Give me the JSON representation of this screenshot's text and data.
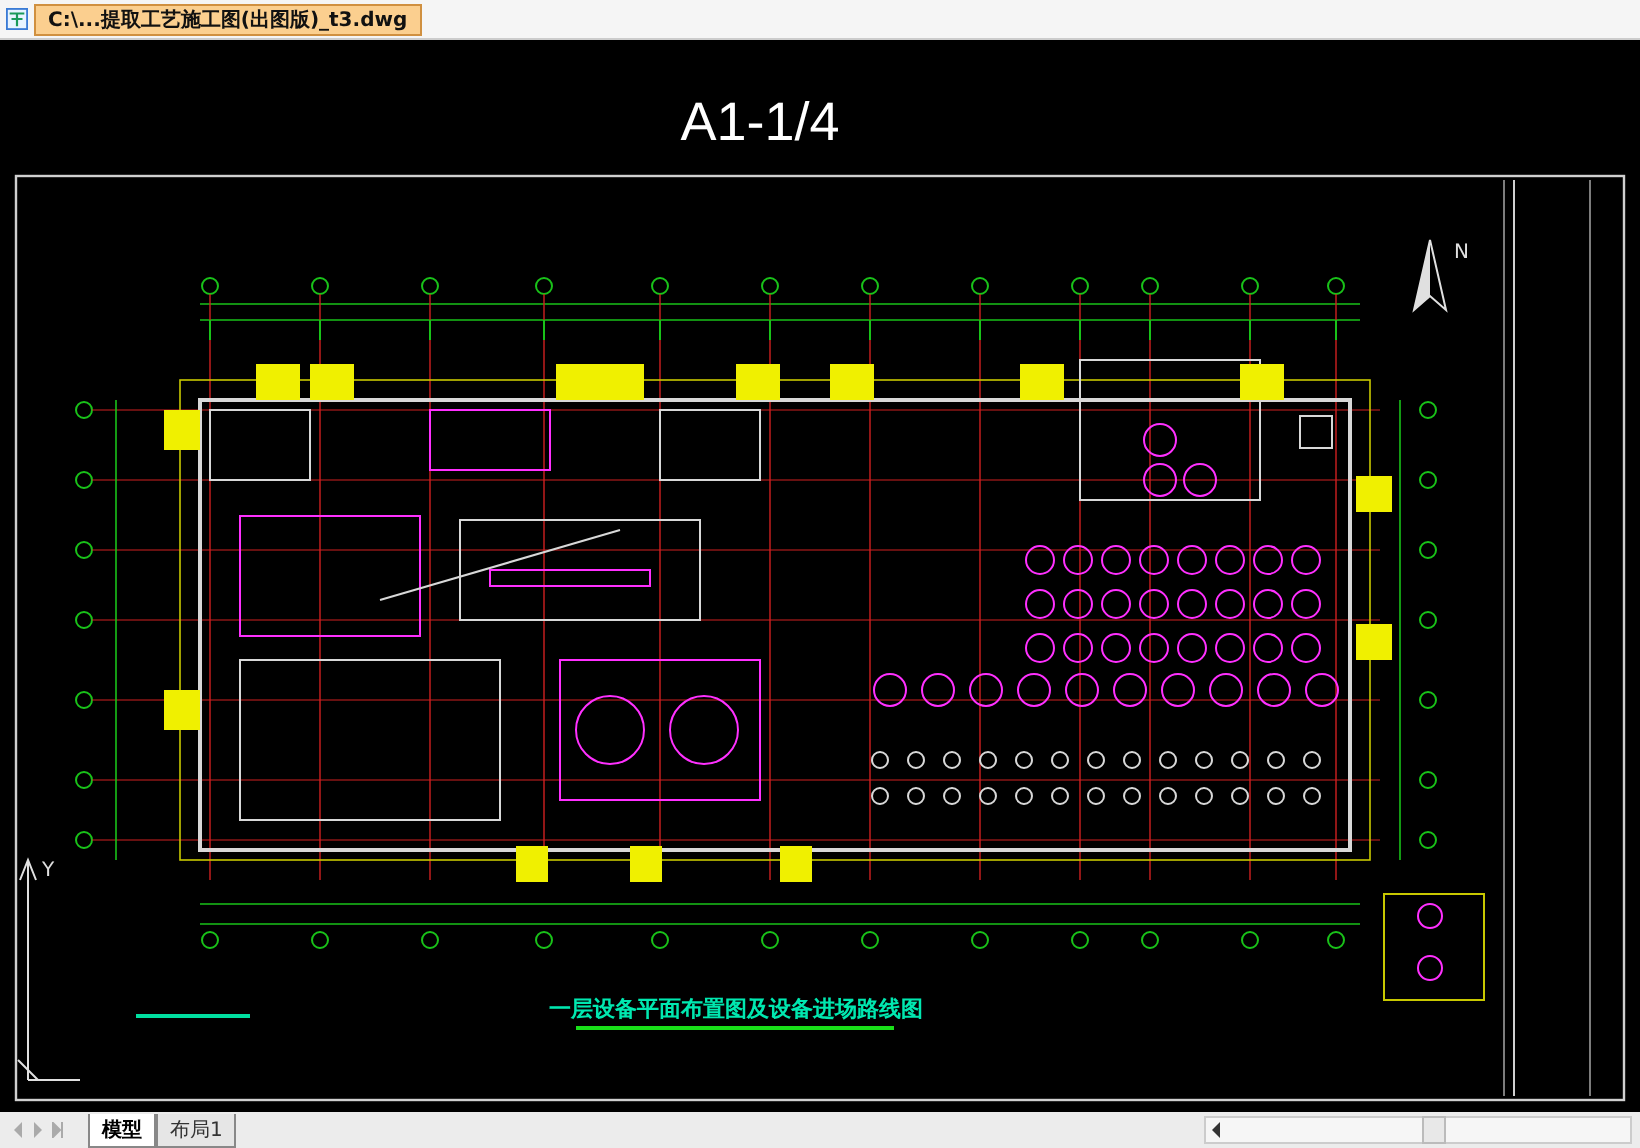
{
  "file_tab": {
    "title": "C:\\...提取工艺施工图(出图版)_t3.dwg",
    "selected": true
  },
  "drawing": {
    "sheet_label": "A1-1/4",
    "north_label": "N",
    "plan_title": "一层设备平面布置图及设备进场路线图",
    "ucs_label": "Y"
  },
  "layout_tabs": [
    {
      "label": "模型",
      "selected": true
    },
    {
      "label": "布局1",
      "selected": false
    }
  ]
}
